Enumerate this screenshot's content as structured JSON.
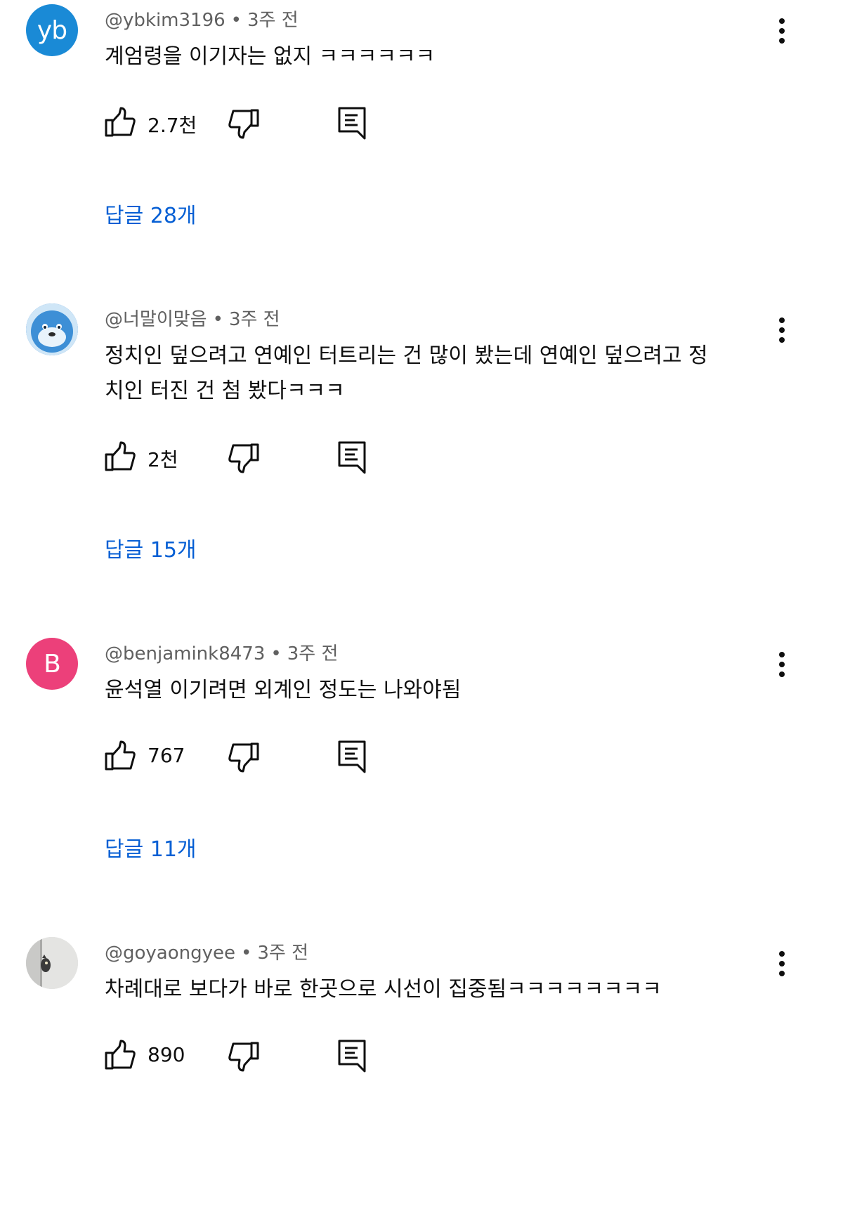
{
  "colors": {
    "replies_link": "#065fd4",
    "meta_text": "#606060",
    "avatar_yb": "#1a8ad6",
    "avatar_b": "#ec407a"
  },
  "comments": [
    {
      "author": "@ybkim3196",
      "time": "3주 전",
      "text": "계엄령을 이기자는 없지 ㅋㅋㅋㅋㅋㅋ",
      "likes": "2.7천",
      "replies": "답글 28개",
      "avatar": {
        "type": "letters",
        "letters": "yb"
      }
    },
    {
      "author": "@너말이맞음",
      "time": "3주 전",
      "text": "정치인 덮으려고 연예인 터트리는 건 많이 봤는데 연예인 덮으려고 정치인 터진 건 첨 봤다ㅋㅋㅋ",
      "likes": "2천",
      "replies": "답글 15개",
      "avatar": {
        "type": "image",
        "icon": "seal-cartoon-avatar"
      }
    },
    {
      "author": "@benjamink8473",
      "time": "3주 전",
      "text": "윤석열 이기려면 외계인 정도는 나와야됨",
      "likes": "767",
      "replies": "답글 11개",
      "avatar": {
        "type": "letters",
        "letters": "B"
      }
    },
    {
      "author": "@goyaongyee",
      "time": "3주 전",
      "text": "차례대로 보다가 바로 한곳으로 시선이 집중됨ㅋㅋㅋㅋㅋㅋㅋㅋ",
      "likes": "890",
      "replies": "",
      "avatar": {
        "type": "image",
        "icon": "cat-peeking-avatar"
      }
    }
  ],
  "icons": {
    "like": "thumb-up-icon",
    "dislike": "thumb-down-icon",
    "reply": "reply-icon",
    "more": "more-vert-icon"
  }
}
